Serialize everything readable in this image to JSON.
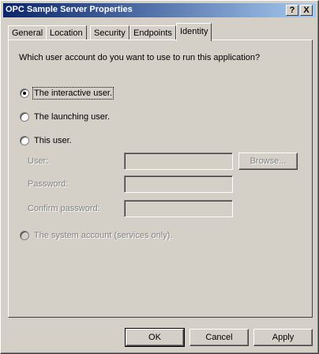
{
  "window": {
    "title": "OPC Sample Server Properties",
    "help_button": "?",
    "close_button": "X"
  },
  "tabs": [
    {
      "label": "General",
      "active": false
    },
    {
      "label": "Location",
      "active": false
    },
    {
      "label": "Security",
      "active": false
    },
    {
      "label": "Endpoints",
      "active": false
    },
    {
      "label": "Identity",
      "active": true
    }
  ],
  "identity": {
    "question": "Which user account do you want to use to run this application?",
    "options": [
      {
        "label": "The interactive user.",
        "selected": true,
        "enabled": true
      },
      {
        "label": "The launching user.",
        "selected": false,
        "enabled": true
      },
      {
        "label": "This user.",
        "selected": false,
        "enabled": true
      },
      {
        "label": "The system account (services only).",
        "selected": false,
        "enabled": false
      }
    ],
    "user_label": "User:",
    "user_value": "",
    "browse_label": "Browse...",
    "password_label": "Password:",
    "password_value": "",
    "confirm_label": "Confirm password:",
    "confirm_value": ""
  },
  "buttons": {
    "ok": "OK",
    "cancel": "Cancel",
    "apply": "Apply"
  }
}
